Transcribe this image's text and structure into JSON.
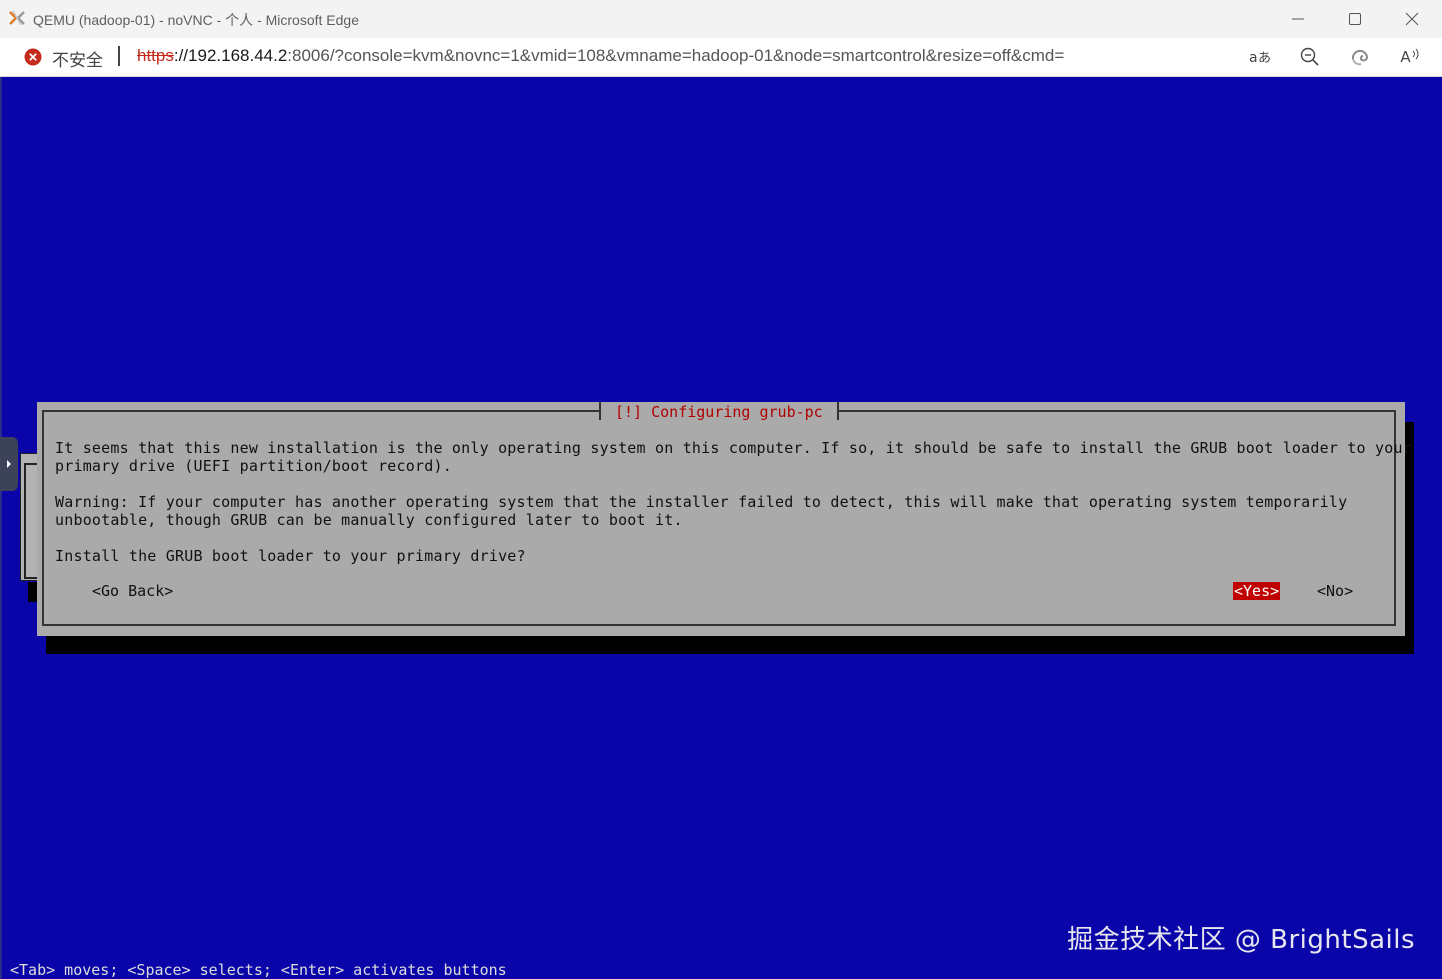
{
  "window": {
    "title": "QEMU (hadoop-01) - noVNC - 个人 - Microsoft Edge"
  },
  "addressbar": {
    "security_label": "不安全",
    "url_scheme": "https",
    "url_host": "://192.168.44.2",
    "url_rest": ":8006/?console=kvm&novnc=1&vmid=108&vmname=hadoop-01&node=smartcontrol&resize=off&cmd=",
    "read_aloud_label": "A"
  },
  "installer": {
    "dialog_title": "[!] Configuring grub-pc",
    "paragraph1_line1": "It seems that this new installation is the only operating system on this computer. If so, it should be safe to install the GRUB boot loader to your",
    "paragraph1_line2": "primary drive (UEFI partition/boot record).",
    "paragraph2_line1": "Warning: If your computer has another operating system that the installer failed to detect, this will make that operating system temporarily",
    "paragraph2_line2": "unbootable, though GRUB can be manually configured later to boot it.",
    "question": "Install the GRUB boot loader to your primary drive?",
    "go_back_label": "<Go Back>",
    "yes_label": "<Yes>",
    "no_label": "<No>",
    "help_text": "<Tab> moves; <Space> selects; <Enter> activates buttons"
  },
  "watermark": "掘金技术社区 @ BrightSails",
  "colors": {
    "vnc_background": "#0a05a8",
    "dialog_background": "#aaaaaa",
    "dialog_title_text": "#b20000",
    "selected_button": "#c00000",
    "insecure_red": "#c42b1c"
  }
}
